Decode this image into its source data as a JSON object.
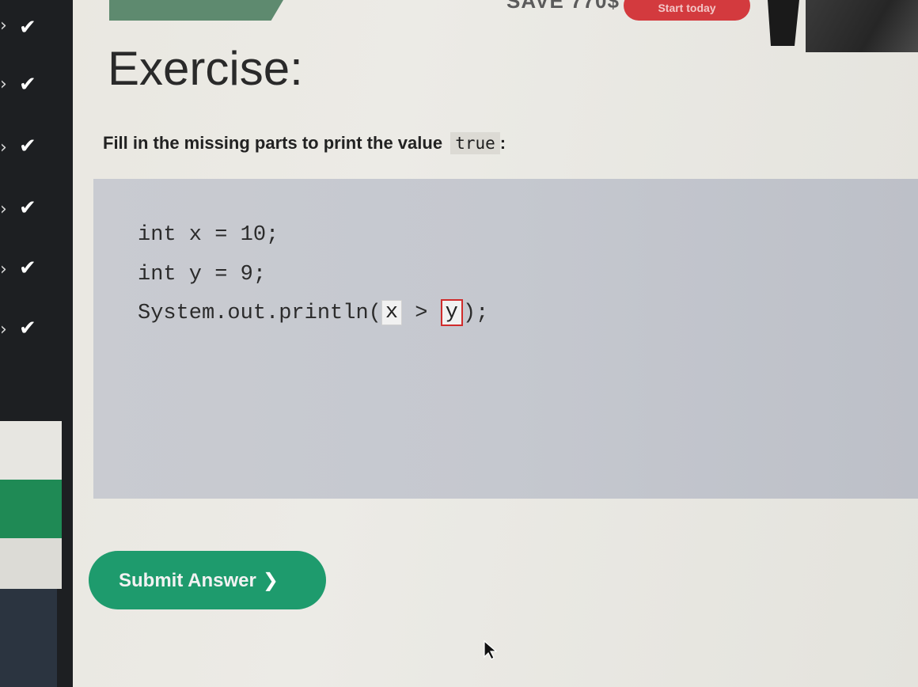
{
  "sidebar": {
    "items": [
      {
        "icon": "check-icon"
      },
      {
        "icon": "check-icon"
      },
      {
        "icon": "check-icon"
      },
      {
        "icon": "check-icon"
      },
      {
        "icon": "check-icon"
      },
      {
        "icon": "check-icon"
      }
    ],
    "check_glyph": "✔",
    "chevron_glyph": "›"
  },
  "top_banner": {
    "promo_text": "SAVE 770$",
    "cta_label": "Start today"
  },
  "exercise": {
    "title": "Exercise:",
    "instruction_prefix": "Fill in the missing parts to print the value",
    "instruction_code": "true",
    "instruction_suffix": ":",
    "code": {
      "line1": "int x = 10;",
      "line2": "int y = 9;",
      "line3_prefix": "System.out.println(",
      "input1_value": "x",
      "operator": " > ",
      "input2_value": "y",
      "line3_suffix": ");"
    },
    "submit_label": "Submit Answer",
    "submit_chevron": "❯"
  },
  "colors": {
    "accent_green": "#1e9b6d",
    "error_red": "#d02b2b",
    "cta_red": "#d33a3e"
  }
}
